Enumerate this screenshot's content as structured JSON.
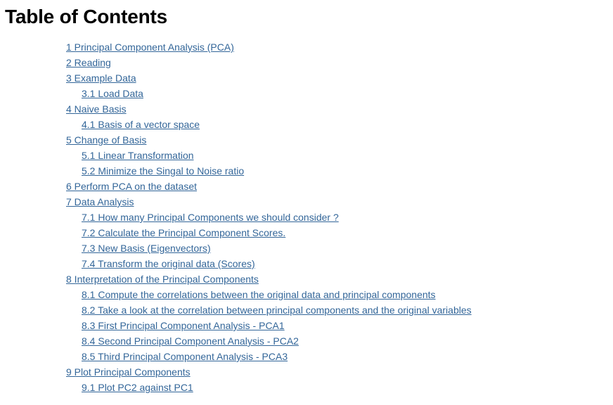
{
  "title": "Table of Contents",
  "toc": [
    {
      "level": 1,
      "text": "1  Principal Component Analysis (PCA)"
    },
    {
      "level": 1,
      "text": "2  Reading"
    },
    {
      "level": 1,
      "text": "3  Example Data"
    },
    {
      "level": 2,
      "text": "3.1  Load Data"
    },
    {
      "level": 1,
      "text": "4  Naive Basis"
    },
    {
      "level": 2,
      "text": "4.1  Basis of a vector space"
    },
    {
      "level": 1,
      "text": "5  Change of Basis"
    },
    {
      "level": 2,
      "text": "5.1  Linear Transformation"
    },
    {
      "level": 2,
      "text": "5.2  Minimize the Singal to Noise ratio"
    },
    {
      "level": 1,
      "text": "6  Perform PCA on the dataset"
    },
    {
      "level": 1,
      "text": "7  Data Analysis"
    },
    {
      "level": 2,
      "text": "7.1  How many Principal Components we should consider ?"
    },
    {
      "level": 2,
      "text": "7.2  Calculate the Principal Component Scores."
    },
    {
      "level": 2,
      "text": "7.3  New Basis (Eigenvectors)"
    },
    {
      "level": 2,
      "text": "7.4  Transform the original data (Scores)"
    },
    {
      "level": 1,
      "text": "8  Interpretation of the Principal Components"
    },
    {
      "level": 2,
      "text": "8.1  Compute the correlations between the original data and principal components"
    },
    {
      "level": 2,
      "text": "8.2  Take a look at the correlation between principal components and the original variables"
    },
    {
      "level": 2,
      "text": "8.3  First Principal Component Analysis - PCA1"
    },
    {
      "level": 2,
      "text": "8.4  Second Principal Component Analysis - PCA2"
    },
    {
      "level": 2,
      "text": "8.5  Third Principal Component Analysis - PCA3"
    },
    {
      "level": 1,
      "text": "9  Plot Principal Components"
    },
    {
      "level": 2,
      "text": "9.1  Plot PC2 against PC1"
    }
  ],
  "colors": {
    "link": "#336699",
    "title": "#000000",
    "background": "#ffffff"
  }
}
